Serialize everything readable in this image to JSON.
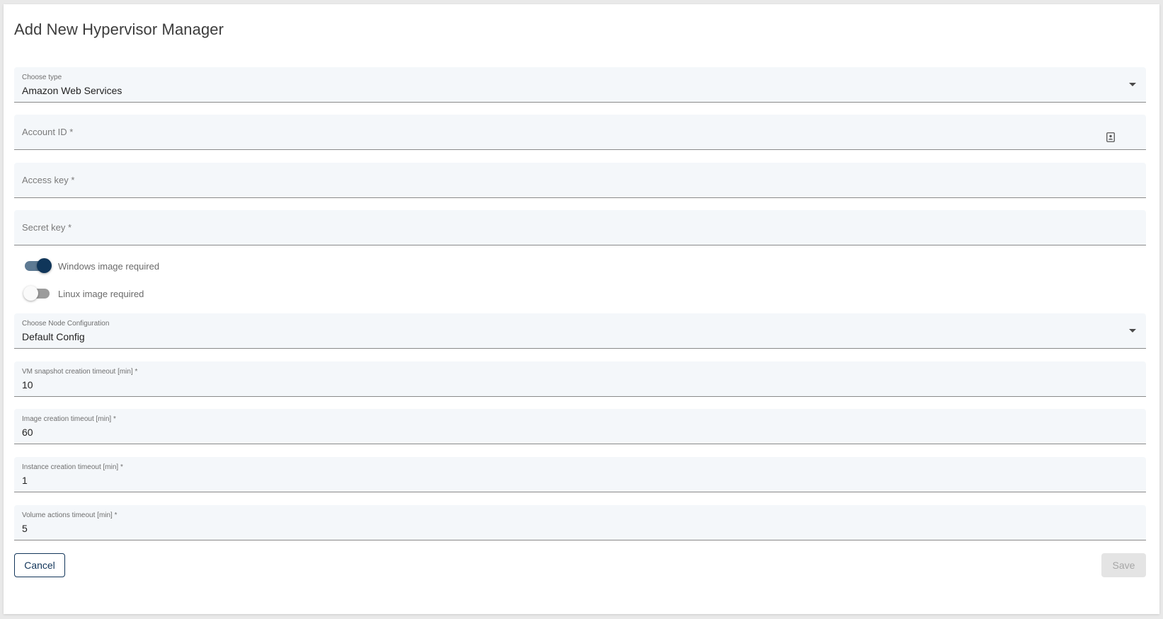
{
  "dialog": {
    "title": "Add New Hypervisor Manager"
  },
  "type_select": {
    "label": "Choose type",
    "value": "Amazon Web Services",
    "icon": "chevron-down-icon"
  },
  "account_id": {
    "placeholder": "Account ID *",
    "value": "",
    "icon": "contact-card-icon"
  },
  "access_key": {
    "placeholder": "Access key *",
    "value": ""
  },
  "secret_key": {
    "placeholder": "Secret key *",
    "value": ""
  },
  "windows_toggle": {
    "label": "Windows image required",
    "checked": true
  },
  "linux_toggle": {
    "label": "Linux image required",
    "checked": false
  },
  "node_config_select": {
    "label": "Choose Node Configuration",
    "value": "Default Config",
    "icon": "chevron-down-icon"
  },
  "vm_snapshot_timeout": {
    "label": "VM snapshot creation timeout [min] *",
    "value": "10"
  },
  "image_creation_timeout": {
    "label": "Image creation timeout [min] *",
    "value": "60"
  },
  "instance_creation_timeout": {
    "label": "Instance creation timeout [min] *",
    "value": "1"
  },
  "volume_actions_timeout": {
    "label": "Volume actions timeout [min] *",
    "value": "5"
  },
  "actions": {
    "cancel_label": "Cancel",
    "save_label": "Save",
    "save_enabled": false
  },
  "colors": {
    "primary": "#12355a",
    "field_bg": "#f4f7fa",
    "toggle_on_knob": "#10365a",
    "disabled_bg": "#e4e4e4"
  }
}
